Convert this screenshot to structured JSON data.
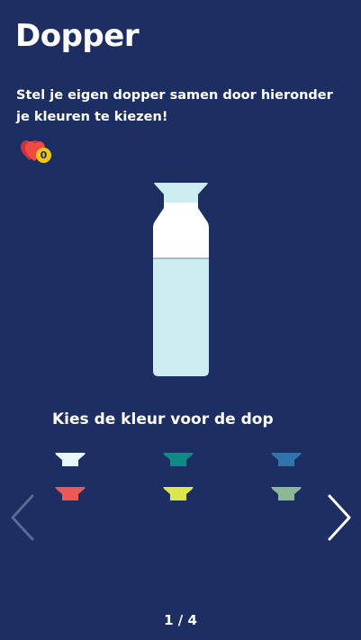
{
  "header": {
    "title": "Dopper",
    "subtitle": "Stel je eigen dopper samen door hieronder je kleuren te kiezen!"
  },
  "favorites": {
    "icon": "hearts-icon",
    "count": "0"
  },
  "bottle": {
    "cap_color": "#cdeef0",
    "neck_color": "#ffffff",
    "body_color": "#cdeef0"
  },
  "picker": {
    "prompt": "Kies de kleur voor de dop",
    "colors": [
      "#e8f7f7",
      "#0f8a84",
      "#2f74ad",
      "#ef5753",
      "#dce64a",
      "#8db896"
    ]
  },
  "pager": {
    "text": "1 / 4"
  },
  "theme": {
    "background": "#1c2e62",
    "accent": "#f2c51a",
    "heart": "#e8403a"
  }
}
